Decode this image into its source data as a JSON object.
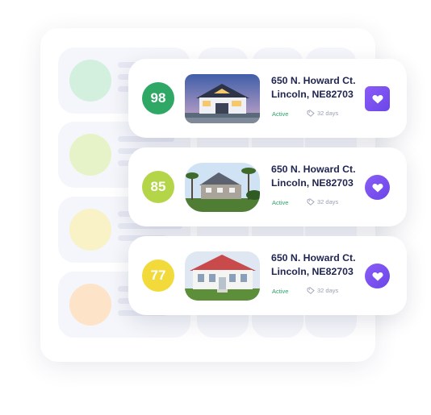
{
  "colors": {
    "accent": "#7a52f0",
    "active": "#2aa46a",
    "text_primary": "#1f2450",
    "text_muted": "#9aa0b4"
  },
  "background_rows": [
    {
      "circle_color": "#d3f0df"
    },
    {
      "circle_color": "#e6f3c8"
    },
    {
      "circle_color": "#f8f2c6"
    },
    {
      "circle_color": "#fde3c8"
    }
  ],
  "listings": [
    {
      "score": "98",
      "score_color": "#2fa866",
      "address_line1": "650 N. Howard Ct.",
      "address_line2": "Lincoln, NE82703",
      "status": "Active",
      "days": "32 days",
      "thumbnail": "modern-house-at-dusk",
      "favorite_icon": "heart-icon"
    },
    {
      "score": "85",
      "score_color": "#b4d548",
      "address_line1": "650 N. Howard Ct.",
      "address_line2": "Lincoln, NE82703",
      "status": "Active",
      "days": "32 days",
      "thumbnail": "stone-house-with-palms",
      "favorite_icon": "heart-icon"
    },
    {
      "score": "77",
      "score_color": "#f1da3a",
      "address_line1": "650 N. Howard Ct.",
      "address_line2": "Lincoln, NE82703",
      "status": "Active",
      "days": "32 days",
      "thumbnail": "white-house-red-roof",
      "favorite_icon": "heart-icon"
    }
  ]
}
